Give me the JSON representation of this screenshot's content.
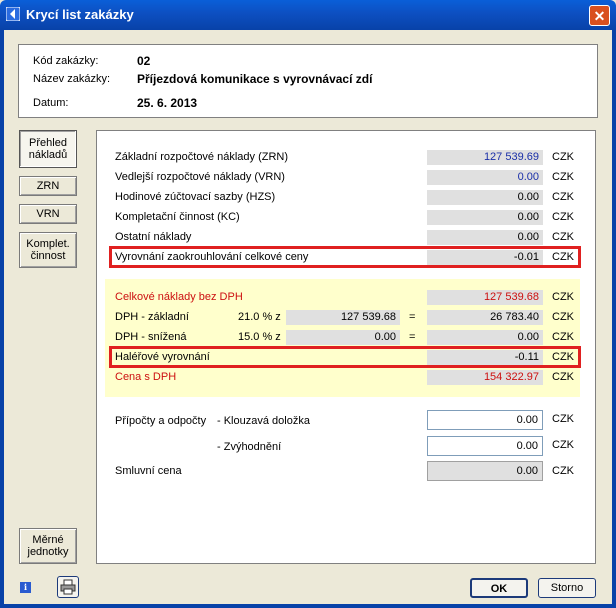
{
  "window": {
    "title": "Krycí list zakázky",
    "close_label": "✕"
  },
  "header": {
    "code_label": "Kód zakázky:",
    "code_value": "02",
    "name_label": "Název zakázky:",
    "name_value": "Příjezdová komunikace s vyrovnávací zdí",
    "date_label": "Datum:",
    "date_value": "25. 6. 2013"
  },
  "sidebar": {
    "overview": "Přehled nákladů",
    "zrn": "ZRN",
    "vrn": "VRN",
    "kc": "Komplet. činnost",
    "units": "Měrné jednotky"
  },
  "costs": {
    "currency": "CZK",
    "rows": [
      {
        "label": "Základní rozpočtové náklady (ZRN)",
        "value": "127 539.69"
      },
      {
        "label": "Vedlejší rozpočtové náklady (VRN)",
        "value": "0.00"
      },
      {
        "label": "Hodinové zúčtovací sazby (HZS)",
        "value": "0.00"
      },
      {
        "label": "Kompletační činnost (KC)",
        "value": "0.00"
      },
      {
        "label": "Ostatní náklady",
        "value": "0.00"
      },
      {
        "label": "Vyrovnání zaokrouhlování celkové ceny",
        "value": "-0.01"
      }
    ]
  },
  "vat": {
    "total_label": "Celkové náklady bez DPH",
    "total_value": "127 539.68",
    "basic_label": "DPH  - základní",
    "basic_rate": "21.0 % z",
    "basic_base": "127 539.68",
    "basic_eq": "=",
    "basic_value": "26 783.40",
    "reduced_label": "DPH  - snížená",
    "reduced_rate": "15.0 % z",
    "reduced_base": "0.00",
    "reduced_eq": "=",
    "reduced_value": "0.00",
    "halere_label": "Haléřové vyrovnání",
    "halere_value": "-0.11",
    "with_vat_label": "Cena s DPH",
    "with_vat_value": "154 322.97"
  },
  "adjustments": {
    "label": "Přípočty a odpočty",
    "sliding_label": "- Klouzavá doložka",
    "sliding_value": "0.00",
    "advantage_label": "- Zvýhodnění",
    "advantage_value": "0.00",
    "contract_label": "Smluvní cena",
    "contract_value": "0.00"
  },
  "footer": {
    "ok": "OK",
    "cancel": "Storno"
  },
  "colors": {
    "accent_blue": "#1a2fa8",
    "accent_red": "#cc1010",
    "highlight_frame": "#e02020",
    "yellow_panel": "#ffffcc"
  }
}
